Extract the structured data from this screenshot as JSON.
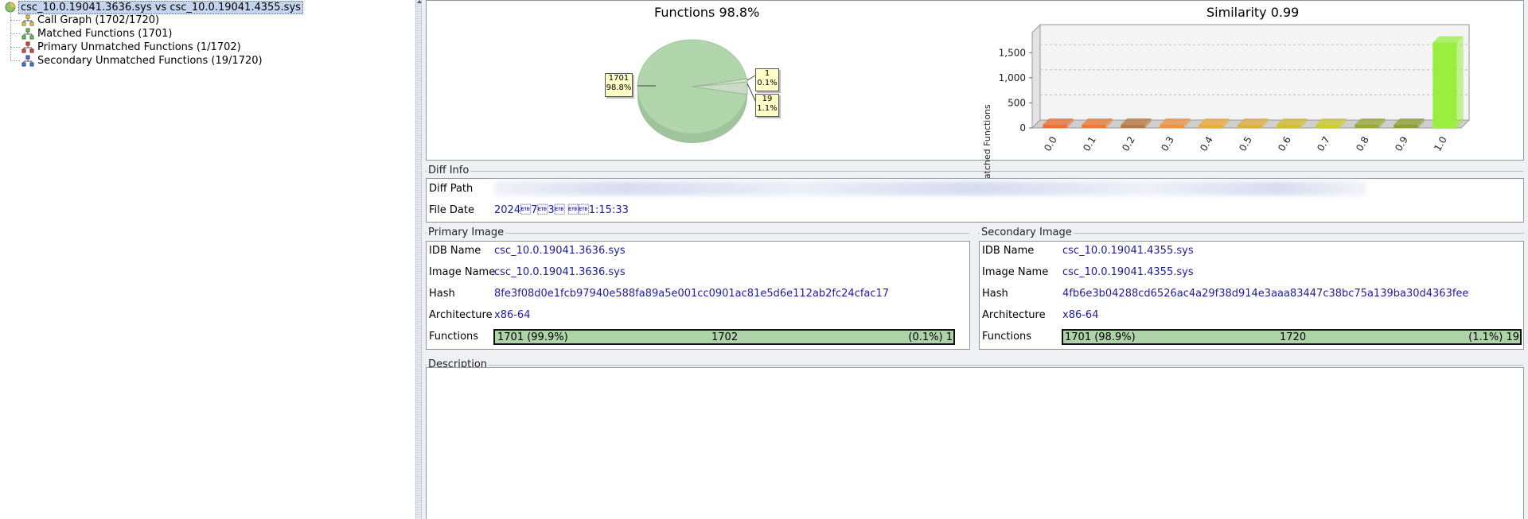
{
  "tree": {
    "root_label": "csc_10.0.19041.3636.sys vs csc_10.0.19041.4355.sys",
    "items": [
      {
        "label": "Call Graph (1702/1720)",
        "icon": "call-graph-icon"
      },
      {
        "label": "Matched Functions (1701)",
        "icon": "matched-functions-icon"
      },
      {
        "label": "Primary Unmatched Functions (1/1702)",
        "icon": "primary-unmatched-icon"
      },
      {
        "label": "Secondary Unmatched Functions (19/1720)",
        "icon": "secondary-unmatched-icon"
      }
    ]
  },
  "pie": {
    "title": "Functions 98.8%",
    "callouts": [
      {
        "count": "1701",
        "pct": "98.8%"
      },
      {
        "count": "1",
        "pct": "0.1%"
      },
      {
        "count": "19",
        "pct": "1.1%"
      }
    ]
  },
  "bar": {
    "title": "Similarity 0.99",
    "ylabel": "Matched Functions"
  },
  "chart_data": [
    {
      "type": "pie",
      "title": "Functions 98.8%",
      "slices": [
        {
          "label": "1701",
          "value": 1701,
          "percent": 98.8,
          "color": "#aed3a8"
        },
        {
          "label": "1",
          "value": 1,
          "percent": 0.1,
          "color": "#c7d8c3"
        },
        {
          "label": "19",
          "value": 19,
          "percent": 1.1,
          "color": "#b7c8b3"
        }
      ]
    },
    {
      "type": "bar",
      "title": "Similarity 0.99",
      "xlabel": "",
      "ylabel": "Matched Functions",
      "categories": [
        "0.0",
        "0.1",
        "0.2",
        "0.3",
        "0.4",
        "0.5",
        "0.6",
        "0.7",
        "0.8",
        "0.9",
        "1.0"
      ],
      "values": [
        0,
        0,
        0,
        0,
        0,
        0,
        0,
        0,
        0,
        0,
        1701
      ],
      "colors": [
        "#f07030",
        "#ee7a35",
        "#b87a40",
        "#ee9440",
        "#eeaa3a",
        "#dcb03a",
        "#d6be30",
        "#cccc2a",
        "#9aaa30",
        "#8ea030",
        "#99ee40"
      ],
      "ylim": [
        0,
        1900
      ],
      "yticks": [
        "0",
        "500",
        "1,000",
        "1,500"
      ],
      "grid": true
    }
  ],
  "diff_info": {
    "title": "Diff Info",
    "path_label": "Diff Path",
    "date_label": "File Date",
    "date_value": "2024\u00177\u00173\u0017 \u0017\u00171:15:33"
  },
  "primary": {
    "title": "Primary Image",
    "idb_label": "IDB Name",
    "idb_value": "csc_10.0.19041.3636.sys",
    "image_label": "Image Name",
    "image_value": "csc_10.0.19041.3636.sys",
    "hash_label": "Hash",
    "hash_value": "8fe3f08d0e1fcb97940e588fa89a5e001cc0901ac81e5d6e112ab2fc24cfac17",
    "arch_label": "Architecture",
    "arch_value": "x86-64",
    "func_label": "Functions",
    "func_left": "1701 (99.9%)",
    "func_mid": "1702",
    "func_right": "(0.1%) 1",
    "matched_fraction": 0.999
  },
  "secondary": {
    "title": "Secondary Image",
    "idb_label": "IDB Name",
    "idb_value": "csc_10.0.19041.4355.sys",
    "image_label": "Image Name",
    "image_value": "csc_10.0.19041.4355.sys",
    "hash_label": "Hash",
    "hash_value": "4fb6e3b04288cd6526ac4a29f38d914e3aaa83447c38bc75a139ba30d4363fee",
    "arch_label": "Architecture",
    "arch_value": "x86-64",
    "func_label": "Functions",
    "func_left": "1701 (98.9%)",
    "func_mid": "1720",
    "func_right": "(1.1%) 19",
    "matched_fraction": 0.989
  },
  "description": {
    "title": "Description"
  }
}
